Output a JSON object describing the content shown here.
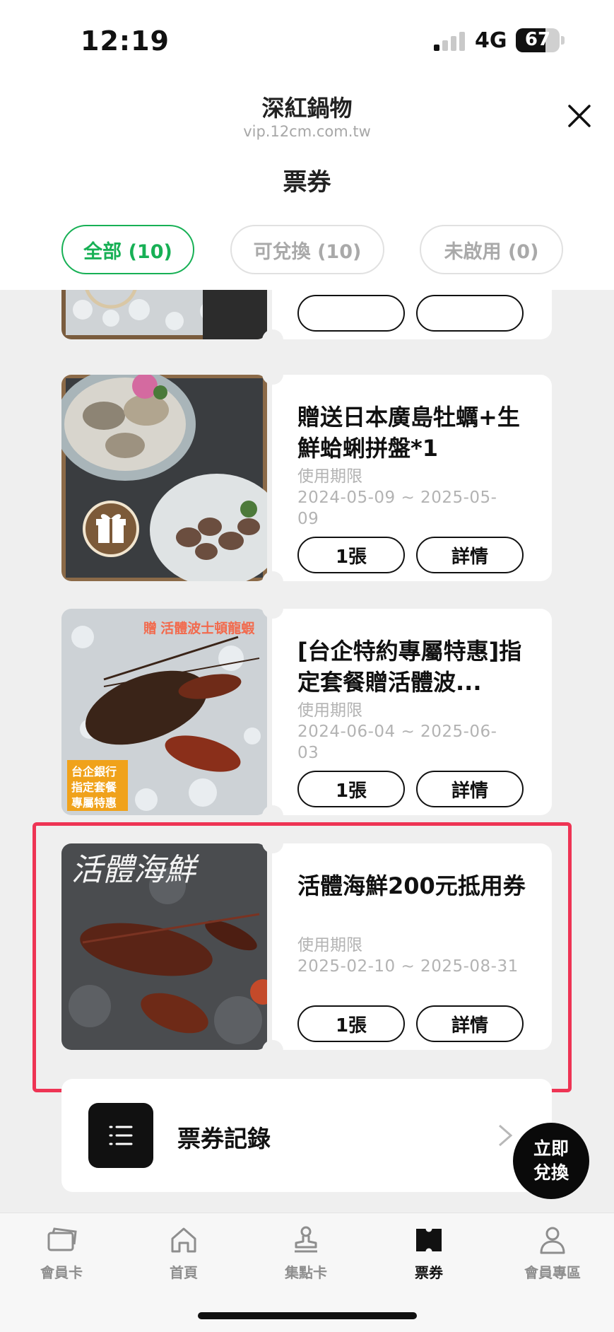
{
  "status": {
    "time": "12:19",
    "network": "4G",
    "battery": "67"
  },
  "header": {
    "title": "深紅鍋物",
    "url": "vip.12cm.com.tw",
    "page_title": "票券"
  },
  "tabs": [
    {
      "label": "全部 (10)",
      "active": true
    },
    {
      "label": "可兌換 (10)",
      "active": false
    },
    {
      "label": "未啟用 (0)",
      "active": false
    }
  ],
  "coupons": [
    {
      "name": "贈送日本廣島牡蠣+生鮮蛤蜊拼盤*1",
      "period_label": "使用期限",
      "date_line1": "2024-05-09 ~ 2025-05-",
      "date_line2": "09",
      "qty": "1張",
      "detail": "詳情",
      "icon": "gift-icon"
    },
    {
      "name": "[台企特約專屬特惠]指定套餐贈活體波...",
      "period_label": "使用期限",
      "date_line1": "2024-06-04 ~ 2025-06-",
      "date_line2": "03",
      "qty": "1張",
      "detail": "詳情",
      "image_caption_top": "贈 活體波士頓龍蝦",
      "image_caption_box": [
        "台企銀行",
        "指定套餐",
        "專屬特惠"
      ]
    },
    {
      "name": "活體海鮮200元抵用券",
      "period_label": "使用期限",
      "date_line1": "2025-02-10 ~ 2025-08-31",
      "qty": "1張",
      "detail": "詳情",
      "image_caption_top": "活體海鮮"
    }
  ],
  "records": {
    "label": "票券記錄"
  },
  "fab": {
    "line1": "立即",
    "line2": "兌換"
  },
  "bottom_nav": [
    {
      "label": "會員卡",
      "icon": "member-card-icon"
    },
    {
      "label": "首頁",
      "icon": "home-icon"
    },
    {
      "label": "集點卡",
      "icon": "stamp-icon"
    },
    {
      "label": "票券",
      "icon": "ticket-icon",
      "active": true
    },
    {
      "label": "會員專區",
      "icon": "person-icon"
    }
  ],
  "colors": {
    "accent": "#17b055",
    "highlight": "#ee3454",
    "background": "#efefef"
  }
}
